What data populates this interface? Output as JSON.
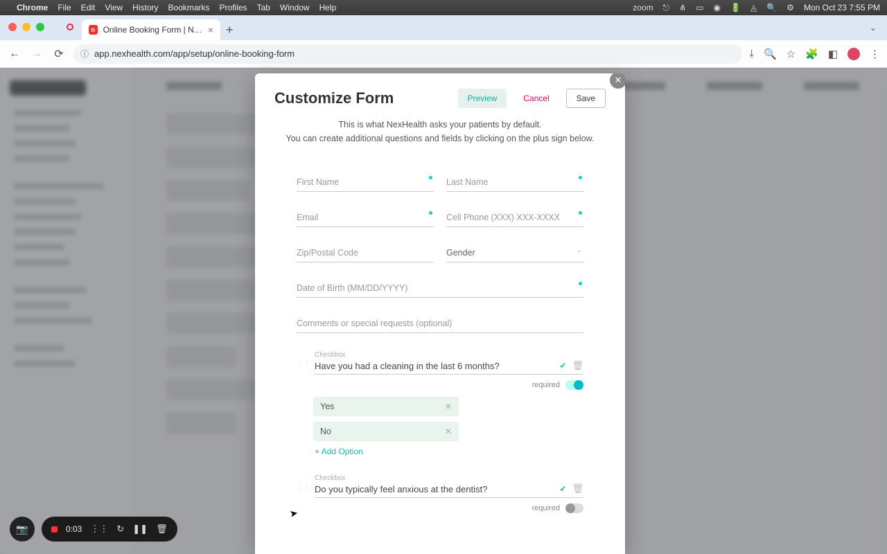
{
  "mac_menu": {
    "app": "Chrome",
    "items": [
      "File",
      "Edit",
      "View",
      "History",
      "Bookmarks",
      "Profiles",
      "Tab",
      "Window",
      "Help"
    ],
    "right_text": "zoom",
    "clock": "Mon Oct 23  7:55 PM"
  },
  "browser": {
    "tab_title": "Online Booking Form | NexHe",
    "url": "app.nexhealth.com/app/setup/online-booking-form"
  },
  "modal": {
    "title": "Customize Form",
    "preview": "Preview",
    "cancel": "Cancel",
    "save": "Save",
    "intro_line1": "This is what NexHealth asks your patients by default.",
    "intro_line2": "You can create additional questions and fields by clicking on the plus sign below.",
    "fields": {
      "first_name": "First Name",
      "last_name": "Last Name",
      "email": "Email",
      "cell": "Cell Phone (XXX) XXX-XXXX",
      "zip": "Zip/Postal Code",
      "gender": "Gender",
      "dob": "Date of Birth (MM/DD/YYYY)",
      "comments": "Comments or special requests (optional)"
    },
    "q1": {
      "type_label": "Checkbox",
      "text": "Have you had a cleaning in the last 6 months?",
      "required_label": "required",
      "required_on": true,
      "options": [
        "Yes",
        "No"
      ],
      "add_option": "+ Add Option"
    },
    "q2": {
      "type_label": "Checkbox",
      "text": "Do you typically feel anxious at the dentist?",
      "required_label": "required",
      "required_on": false
    }
  },
  "recording": {
    "time": "0:03"
  }
}
